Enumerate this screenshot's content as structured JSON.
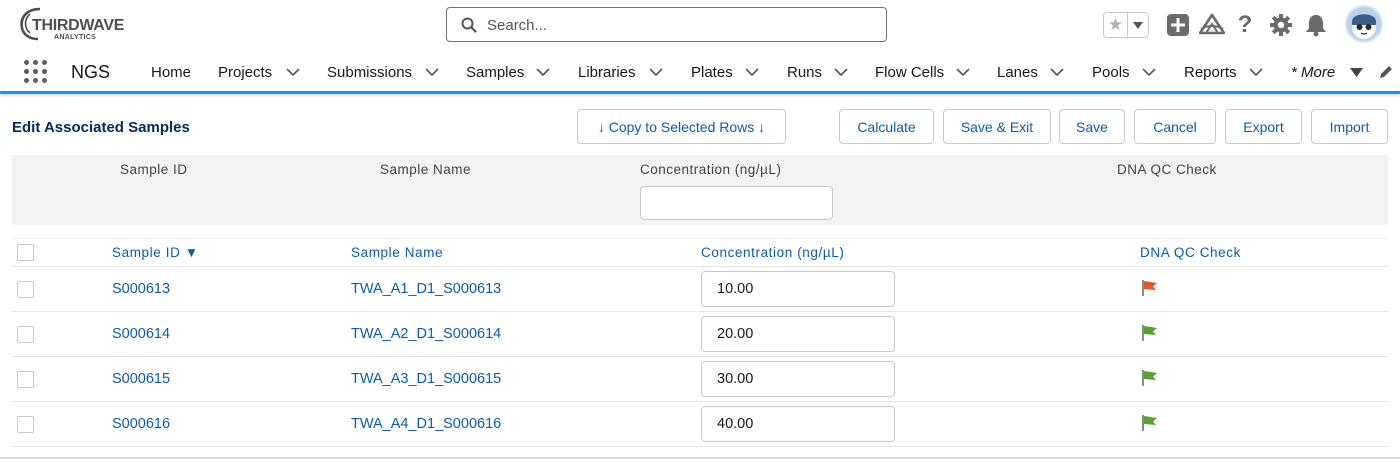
{
  "brand": {
    "logo_main": "THIRDWAVE",
    "logo_sub": "ANALYTICS"
  },
  "search": {
    "placeholder": "Search..."
  },
  "app": {
    "name": "NGS"
  },
  "nav": {
    "items": [
      {
        "label": "Home",
        "has_menu": false
      },
      {
        "label": "Projects",
        "has_menu": true
      },
      {
        "label": "Submissions",
        "has_menu": true
      },
      {
        "label": "Samples",
        "has_menu": true
      },
      {
        "label": "Libraries",
        "has_menu": true
      },
      {
        "label": "Plates",
        "has_menu": true
      },
      {
        "label": "Runs",
        "has_menu": true
      },
      {
        "label": "Flow Cells",
        "has_menu": true
      },
      {
        "label": "Lanes",
        "has_menu": true
      },
      {
        "label": "Pools",
        "has_menu": true
      },
      {
        "label": "Reports",
        "has_menu": true
      }
    ],
    "more_label": "* More"
  },
  "page": {
    "title": "Edit Associated Samples"
  },
  "toolbar": {
    "copy_label": "↓ Copy to Selected Rows ↓",
    "calculate_label": "Calculate",
    "save_exit_label": "Save & Exit",
    "save_label": "Save",
    "cancel_label": "Cancel",
    "export_label": "Export",
    "import_label": "Import"
  },
  "filter": {
    "sample_id_label": "Sample ID",
    "sample_name_label": "Sample Name",
    "concentration_label": "Concentration (ng/µL)",
    "dna_qc_label": "DNA QC Check",
    "concentration_value": ""
  },
  "table": {
    "headers": {
      "sample_id": "Sample ID ▼",
      "sample_name": "Sample Name",
      "concentration": "Concentration (ng/µL)",
      "dna_qc": "DNA QC Check"
    },
    "rows": [
      {
        "sample_id": "S000613",
        "sample_name": "TWA_A1_D1_S000613",
        "concentration": "10.00",
        "qc_flag": "red"
      },
      {
        "sample_id": "S000614",
        "sample_name": "TWA_A2_D1_S000614",
        "concentration": "20.00",
        "qc_flag": "green"
      },
      {
        "sample_id": "S000615",
        "sample_name": "TWA_A3_D1_S000615",
        "concentration": "30.00",
        "qc_flag": "green"
      },
      {
        "sample_id": "S000616",
        "sample_name": "TWA_A4_D1_S000616",
        "concentration": "40.00",
        "qc_flag": "green"
      }
    ]
  },
  "colors": {
    "accent": "#1b96ff",
    "link": "#0b5cab",
    "title": "#032d60",
    "flag_red": "#e3562c",
    "flag_green": "#5aa02c"
  },
  "icons": [
    "search-icon",
    "star-icon",
    "chevron-down-icon",
    "add-icon",
    "trailhead-icon",
    "help-icon",
    "gear-icon",
    "bell-icon",
    "avatar",
    "app-launcher-icon",
    "pencil-icon",
    "flag-icon"
  ]
}
